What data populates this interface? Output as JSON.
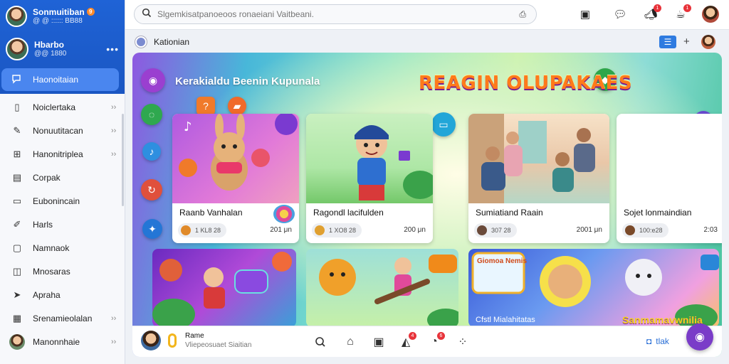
{
  "sidebar": {
    "account_primary": {
      "name": "Sonmuitiban",
      "sub": "@ @ :::::: BB88",
      "badge": "9"
    },
    "account_secondary": {
      "name": "Hbarbo",
      "sub": "@@ 1880",
      "menu": "•••"
    },
    "active_item": {
      "label": "Haonoitaian",
      "icon": "chat-icon"
    },
    "items": [
      {
        "label": "Noiclertaka",
        "icon": "document-icon"
      },
      {
        "label": "Nonuutitacan",
        "icon": "pen-icon"
      },
      {
        "label": "Hanonitriplea",
        "icon": "grid-icon"
      },
      {
        "label": "Corpak",
        "icon": "library-icon"
      },
      {
        "label": "Eubonincain",
        "icon": "folder-icon"
      },
      {
        "label": "Harls",
        "icon": "pencil-icon"
      },
      {
        "label": "Namnaok",
        "icon": "bookmark-icon"
      },
      {
        "label": "Mnosaras",
        "icon": "music-icon"
      },
      {
        "label": "Apraha",
        "icon": "send-icon"
      },
      {
        "label": "Srenamieolalan",
        "icon": "calendar-icon"
      },
      {
        "label": "Manonnhaie",
        "icon": "avatar"
      }
    ]
  },
  "topbar": {
    "search_placeholder": "Slgemkisatpanoeoos ronaeiani Vaitbeani.",
    "icons": [
      {
        "name": "tablet-icon",
        "badge": ""
      },
      {
        "name": "chat-bubble-icon",
        "badge": ""
      },
      {
        "name": "megaphone-icon",
        "badge": "1"
      },
      {
        "name": "cup-icon",
        "badge": "1"
      }
    ]
  },
  "breadcrumb": {
    "label": "Kationian",
    "plus": "+"
  },
  "stage": {
    "title": "Kerakialdu Beenin Kupunala",
    "hero_title": "REAGIN OLUPAKAES"
  },
  "cards": [
    {
      "title": "Raanb Vanhalan",
      "meta": "1 KL8 28",
      "time": "201 μn"
    },
    {
      "title": "Ragondl lacifulden",
      "meta": "1 XO8 28",
      "time": "200 μn"
    },
    {
      "title": "Sumiatiand Raain",
      "meta": "307 28",
      "time": "2001 μn"
    },
    {
      "title": "Sojet lonmaindian",
      "meta": "100:e28",
      "time": "2:03"
    }
  ],
  "bottom_cards": [
    {
      "label": ""
    },
    {
      "label": ""
    },
    {
      "label": "Cfstl Mialahitatas",
      "overlay": "Giomoa Nemis",
      "caption": "Sanmamavwnilia"
    }
  ],
  "dock": {
    "name": "Rame",
    "subtitle": "Vliepeosuaet Siaitian",
    "link_label": "tlak",
    "icons": [
      "search-icon",
      "home-icon",
      "calendar-icon",
      "compass-icon",
      "notification-icon",
      "apps-icon"
    ],
    "badges": {
      "compass-icon": "4",
      "notification-icon": "6"
    }
  }
}
